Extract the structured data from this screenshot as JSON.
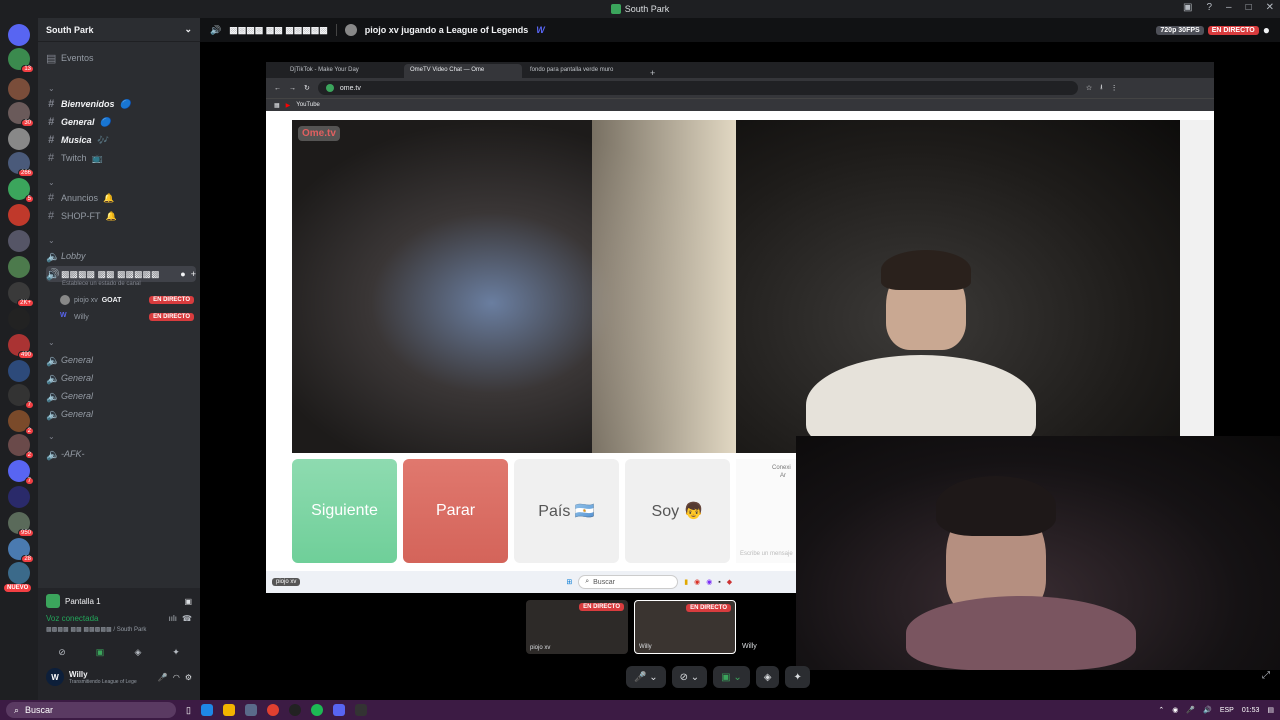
{
  "window": {
    "title": "South Park"
  },
  "guild_badges": [
    "13",
    "30",
    "266",
    "5",
    "2K+",
    "490",
    "7",
    "2",
    "2",
    "7",
    "950",
    "28"
  ],
  "nuevo": "NUEVO",
  "server": {
    "name": "South Park",
    "events": "Eventos"
  },
  "text_channels": [
    {
      "name": "Bienvenidos",
      "emoji": "🔵"
    },
    {
      "name": "General",
      "emoji": "🔵"
    },
    {
      "name": "Musica",
      "emoji": "🎶"
    },
    {
      "name": "Twitch",
      "emoji": "📺"
    }
  ],
  "text_channels2": [
    {
      "name": "Anuncios",
      "emoji": "🔔"
    },
    {
      "name": "SHOP-FT",
      "emoji": "🔔"
    }
  ],
  "voice_channels": {
    "lobby": "Lobby",
    "active": "▩▩▩▩ ▩▩ ▩▩▩▩▩",
    "status_placeholder": "Establece un estado de canal",
    "users": [
      {
        "name": "piojo xv",
        "tag": "GOAT",
        "live": "EN DIRECTO"
      },
      {
        "name": "Willy",
        "live": "EN DIRECTO"
      }
    ],
    "general": [
      "General",
      "General",
      "General",
      "General"
    ],
    "afk": "-AFK-"
  },
  "panel": {
    "screen": "Pantalla 1",
    "connected": "Voz conectada",
    "location": "▩▩▩▩ ▩▩ ▩▩▩▩▩ / South Park",
    "user": "Willy",
    "status": "Transmitiendo League of Legends"
  },
  "topbar": {
    "channel": "▩▩▩▩ ▩▩ ▩▩▩▩▩",
    "stream_title": "piojo xv jugando a League of Legends",
    "quality": "720p 30FPS",
    "live": "EN DIRECTO"
  },
  "browser": {
    "tabs": [
      "DjTikTok - Make Your Day",
      "OmeTV Video Chat — Ome",
      "fondo para pantalla verde muro"
    ],
    "url": "ome.tv",
    "bookmark": "YouTube",
    "logo": "Ome.tv",
    "buttons": {
      "next": "Siguiente",
      "stop": "Parar",
      "country": "País 🇦🇷",
      "gender": "Soy 👦"
    },
    "side_conn": "Conexi",
    "side_ar": "Ar",
    "side_input": "Escribe un mensaje",
    "win_search": "Buscar",
    "win_label": "piojo xv"
  },
  "thumbs": [
    {
      "label": "piojo xv",
      "live": "EN DIRECTO"
    },
    {
      "label": "Willy",
      "live": "EN DIRECTO"
    }
  ],
  "thumb_extra": "Willy",
  "taskbar": {
    "search": "Buscar",
    "lang": "ESP",
    "time": "01:53"
  },
  "colors": {
    "live": "#d83c3e",
    "green": "#3ba55c",
    "accent": "#5865f2"
  }
}
